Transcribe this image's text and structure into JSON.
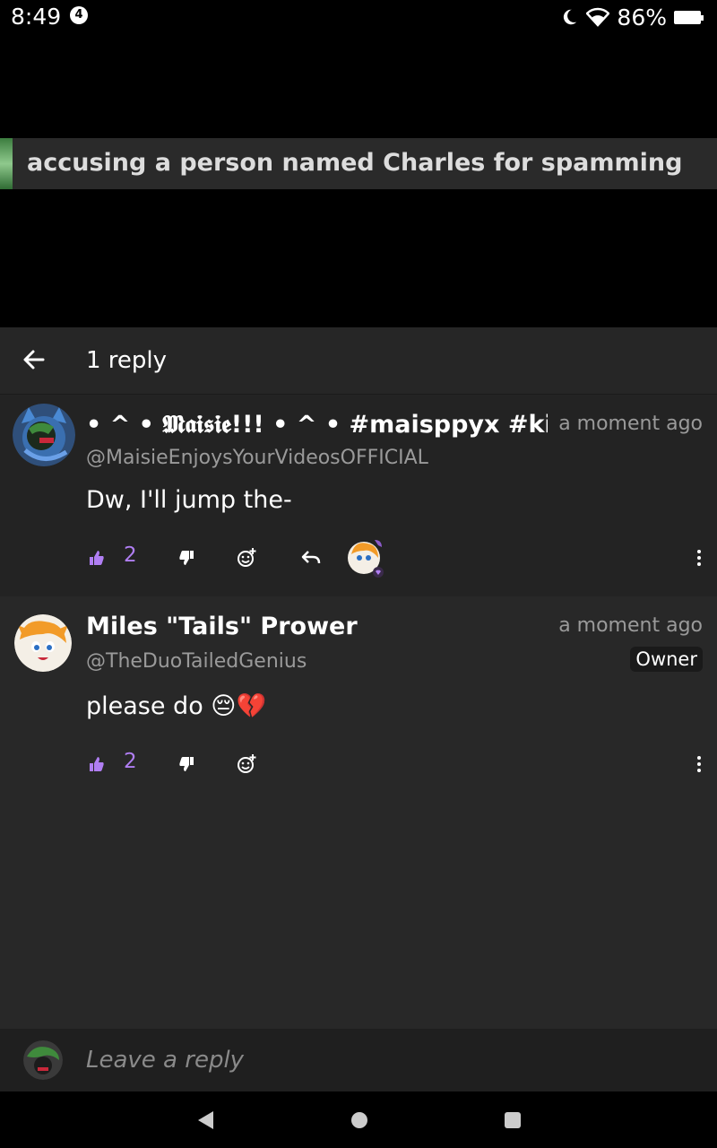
{
  "status_bar": {
    "time": "8:49",
    "notification_count": "4",
    "battery": "86%"
  },
  "video": {
    "caption": "accusing a person named Charles for spamming"
  },
  "panel": {
    "title": "1 reply"
  },
  "comments": [
    {
      "author": "• ^ • 𝕸𝖆𝖎𝖘𝖎𝖊!!! • ^ • #maisppyx #king",
      "handle": "@MaisieEnjoysYourVideosOFFICIAL",
      "timestamp": "a moment ago",
      "text": "Dw, I'll jump the-",
      "likes": "2"
    },
    {
      "author": "Miles \"Tails\" Prower",
      "handle": "@TheDuoTailedGenius",
      "timestamp": "a moment ago",
      "badge": "Owner",
      "text": "please do 😔💔",
      "likes": "2"
    }
  ],
  "reply_bar": {
    "placeholder": "Leave a reply"
  },
  "colors": {
    "accent": "#b07ef3",
    "panel_bg": "#282828",
    "comment_bg": "#232323"
  },
  "icons": [
    "back-arrow-icon",
    "thumb-up-icon",
    "thumb-down-icon",
    "add-reaction-icon",
    "reply-icon",
    "more-vert-icon",
    "moon-icon",
    "wifi-icon",
    "battery-icon",
    "nav-back-icon",
    "nav-home-icon",
    "nav-recents-icon"
  ]
}
